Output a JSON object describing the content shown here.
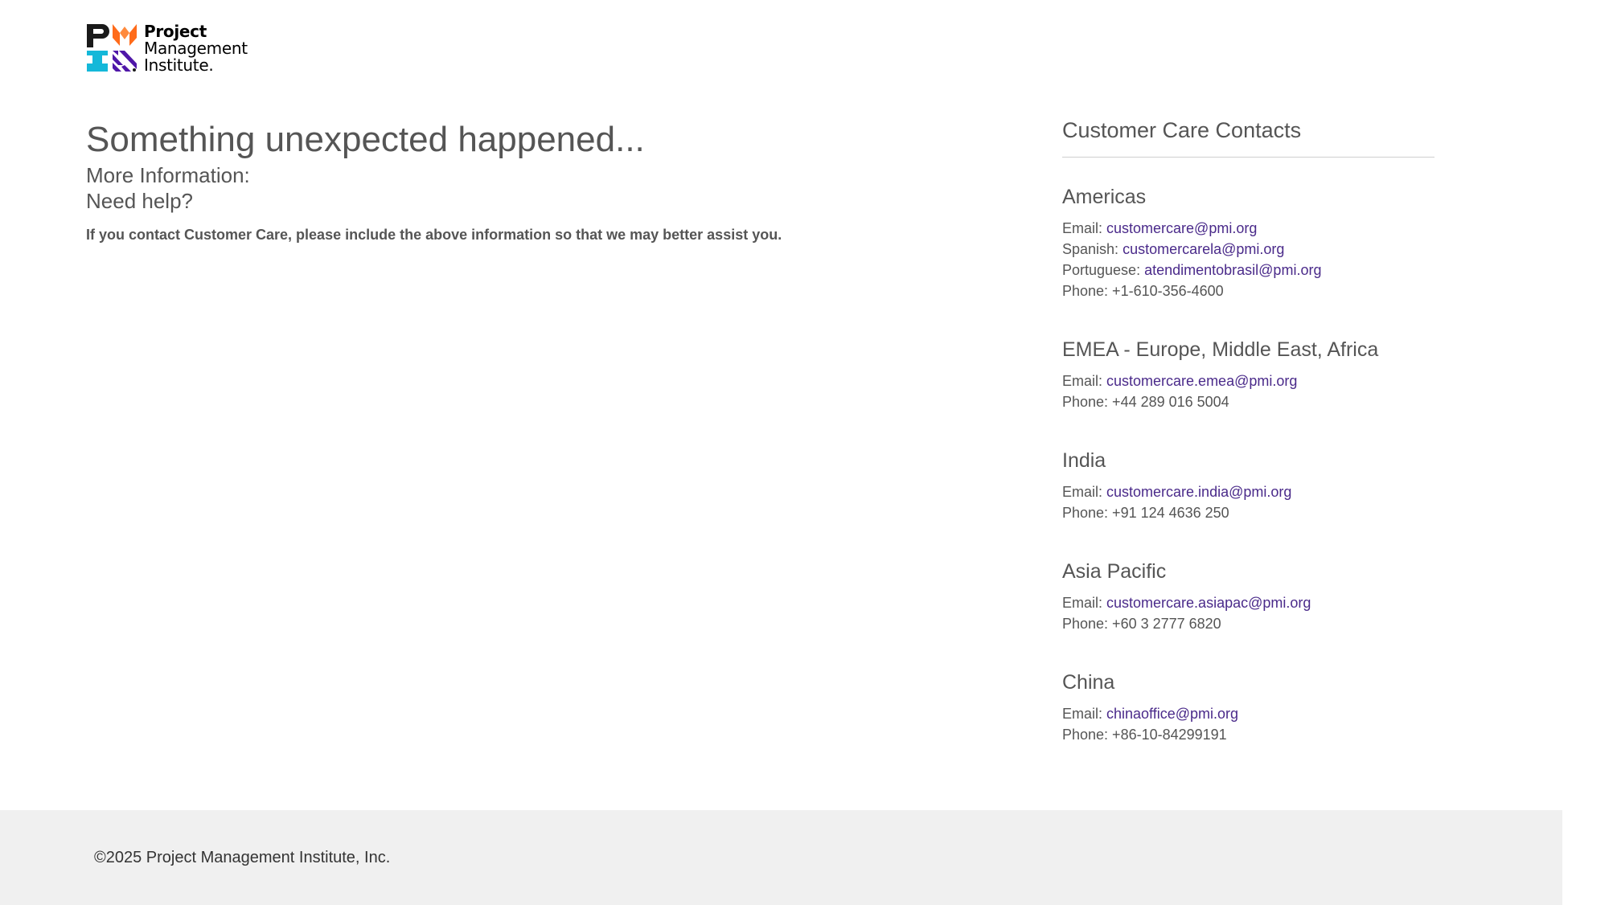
{
  "logo": {
    "line1": "Project",
    "line2": "Management",
    "line3": "Institute."
  },
  "main": {
    "title": "Something unexpected happened...",
    "more_info": "More Information:",
    "need_help": "Need help?",
    "note": "If you contact Customer Care, please include the above information so that we may better assist you."
  },
  "contacts": {
    "heading": "Customer Care Contacts",
    "regions": [
      {
        "name": "Americas",
        "lines": [
          {
            "label": "Email: ",
            "link": "customercare@pmi.org"
          },
          {
            "label": "Spanish: ",
            "link": "customercarela@pmi.org"
          },
          {
            "label": "Portuguese: ",
            "link": "atendimentobrasil@pmi.org"
          },
          {
            "label": "Phone: +1-610-356-4600",
            "link": ""
          }
        ]
      },
      {
        "name": "EMEA - Europe, Middle East, Africa",
        "lines": [
          {
            "label": "Email: ",
            "link": "customercare.emea@pmi.org"
          },
          {
            "label": "Phone: +44 289 016 5004",
            "link": ""
          }
        ]
      },
      {
        "name": "India",
        "lines": [
          {
            "label": "Email: ",
            "link": "customercare.india@pmi.org"
          },
          {
            "label": "Phone: +91 124 4636 250",
            "link": ""
          }
        ]
      },
      {
        "name": "Asia Pacific",
        "lines": [
          {
            "label": "Email: ",
            "link": "customercare.asiapac@pmi.org"
          },
          {
            "label": "Phone: +60 3 2777 6820",
            "link": ""
          }
        ]
      },
      {
        "name": "China",
        "lines": [
          {
            "label": "Email: ",
            "link": "chinaoffice@pmi.org"
          },
          {
            "label": "Phone: +86-10-84299191",
            "link": ""
          }
        ]
      }
    ]
  },
  "footer": {
    "copyright": "©2025 Project Management Institute, Inc."
  },
  "colors": {
    "link": "#4a2a8a",
    "text": "#555555",
    "footer_bg": "#f0f0f0",
    "logo_orange": "#ff6b1a",
    "logo_cyan": "#14b8d9",
    "logo_purple": "#4f17a8"
  }
}
